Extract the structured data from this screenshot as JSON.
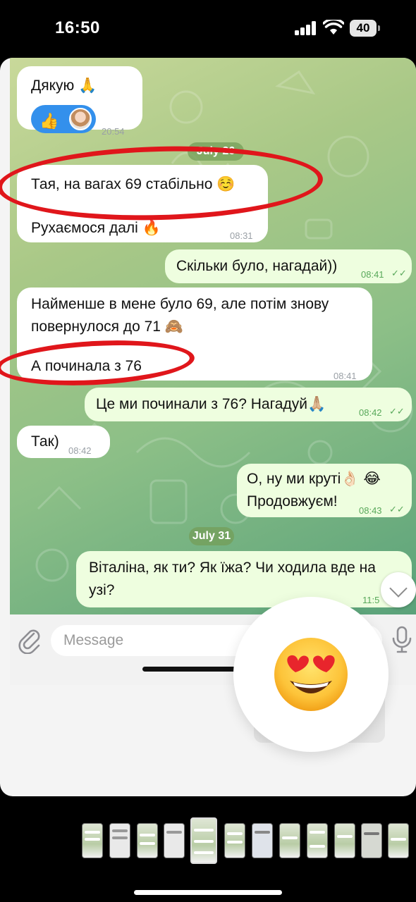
{
  "status_bar": {
    "time": "16:50",
    "battery": "40"
  },
  "messages": [
    {
      "id": "m1",
      "dir": "in",
      "lines": [
        "Дякую 🙏"
      ],
      "time": "20:54"
    },
    {
      "id": "m2",
      "dir": "in",
      "lines": [
        "Тая, на вагах 69 стабільно ☺️",
        "Рухаємося далі 🔥"
      ],
      "time": "08:31"
    },
    {
      "id": "m3",
      "dir": "out",
      "lines": [
        "Скільки було, нагадай))"
      ],
      "time": "08:41"
    },
    {
      "id": "m4",
      "dir": "in",
      "lines": [
        "Найменше в мене було 69, але потім знову",
        "повернулося до 71 🙈",
        "А починала з 76"
      ],
      "time": "08:41"
    },
    {
      "id": "m5",
      "dir": "out",
      "lines": [
        "Це ми починали з 76? Нагадуй🙏🏼"
      ],
      "time": "08:42"
    },
    {
      "id": "m6",
      "dir": "in",
      "lines": [
        "Так)"
      ],
      "time": "08:42"
    },
    {
      "id": "m7",
      "dir": "out",
      "lines": [
        "О, ну ми круті👌🏻 😂",
        "Продовжуєм!"
      ],
      "time": "08:43"
    },
    {
      "id": "m8",
      "dir": "out",
      "lines": [
        "Віталіна, як ти? Як їжа? Чи ходила вде на",
        "узі?"
      ],
      "time": "11:5"
    }
  ],
  "date_separators": [
    "July 26",
    "July 31"
  ],
  "reactions": {
    "first": "👍",
    "big": "😍"
  },
  "input": {
    "placeholder": "Message"
  },
  "icons": [
    "attach-icon",
    "microphone-icon",
    "chevron-down-icon",
    "signal-icon",
    "wifi-icon",
    "battery-icon"
  ],
  "colors": {
    "incoming_bubble": "#ffffff",
    "outgoing_bubble": "#eefedf",
    "annotation": "#e0161b",
    "reaction_pill": "#3390ec"
  }
}
